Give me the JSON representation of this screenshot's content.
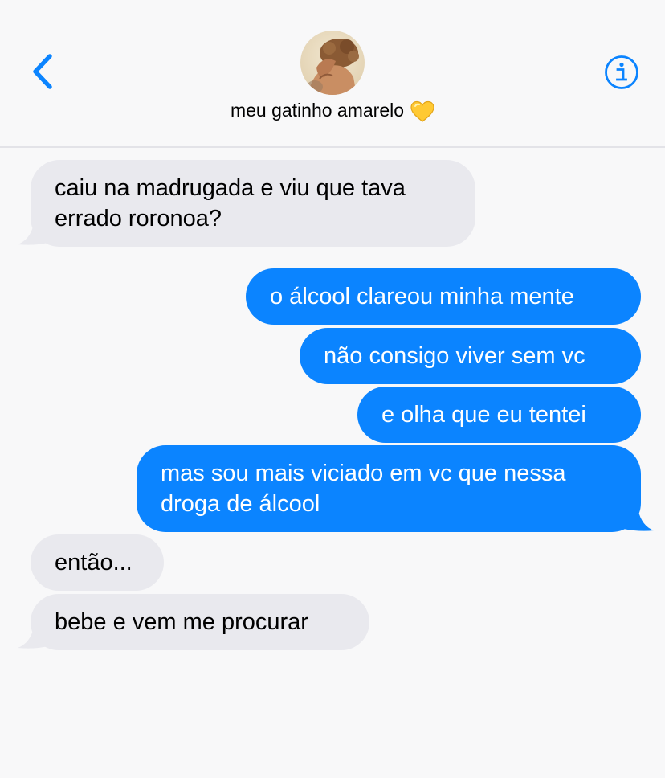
{
  "header": {
    "contact_name": "meu gatinho amarelo"
  },
  "icons": {
    "back": "chevron-left-icon",
    "info": "info-icon",
    "heart": "yellow-heart-emoji"
  },
  "colors": {
    "accent": "#0b84ff",
    "incoming_bubble": "#e9e9ee",
    "background": "#f8f8f9"
  },
  "messages": [
    {
      "direction": "incoming",
      "text": "caiu na madrugada e viu que tava errado roronoa?"
    },
    {
      "direction": "outgoing",
      "text": "o álcool clareou minha mente"
    },
    {
      "direction": "outgoing",
      "text": "não consigo viver sem vc"
    },
    {
      "direction": "outgoing",
      "text": "e olha que eu tentei"
    },
    {
      "direction": "outgoing",
      "text": "mas sou mais viciado em vc que nessa droga de álcool"
    },
    {
      "direction": "incoming",
      "text": "então..."
    },
    {
      "direction": "incoming",
      "text": "bebe e vem me procurar"
    }
  ]
}
